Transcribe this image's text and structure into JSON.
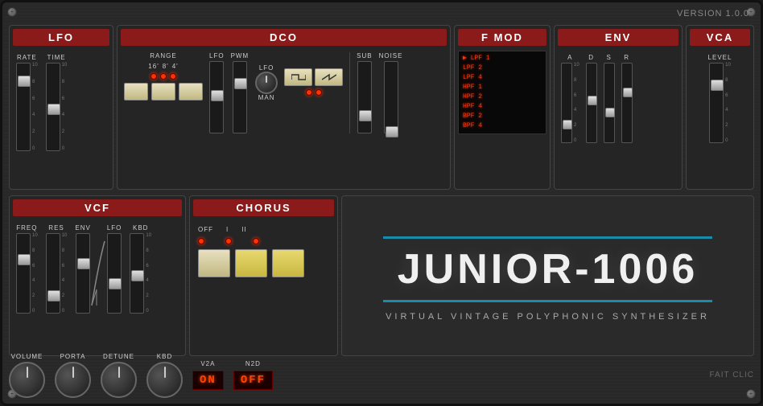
{
  "version": "VERSION 1.0.0",
  "sections": {
    "lfo": {
      "title": "LFO",
      "labels": [
        "RATE",
        "TIME"
      ],
      "ticks": [
        "10",
        "8",
        "6",
        "4",
        "2",
        "0"
      ]
    },
    "dco": {
      "title": "DCO",
      "range_label": "RANGE",
      "range_options": [
        "16'",
        "8'",
        "4'"
      ],
      "labels": [
        "LFO",
        "PWM"
      ],
      "sub_label": "SUB",
      "noise_label": "NOISE",
      "lfo_label": "LFO",
      "man_label": "MAN"
    },
    "fmod": {
      "title": "F MOD",
      "filters": [
        "LPF 1",
        "LPF 2",
        "LPF 4",
        "HPF 1",
        "HPF 2",
        "HPF 4",
        "BPF 2",
        "BPF 4"
      ]
    },
    "env": {
      "title": "ENV",
      "labels": [
        "A",
        "D",
        "S",
        "R"
      ]
    },
    "vca": {
      "title": "VCA",
      "label": "LEVEL"
    },
    "vcf": {
      "title": "VCF",
      "labels": [
        "FREQ",
        "RES",
        "ENV",
        "LFO",
        "KBD"
      ]
    },
    "chorus": {
      "title": "CHORUS",
      "options": [
        "OFF",
        "I",
        "II"
      ]
    },
    "main": {
      "title": "JUNIOR-1006",
      "subtitle": "VIRTUAL VINTAGE POLYPHONIC SYNTHESIZER"
    }
  },
  "footer": {
    "controls": [
      "VOLUME",
      "PORTA",
      "DETUNE",
      "KBD"
    ],
    "v2a_label": "V2A",
    "v2a_value": "ON",
    "n2d_label": "N2D",
    "n2d_value": "OFF",
    "brand": "FAIT CLIC"
  }
}
